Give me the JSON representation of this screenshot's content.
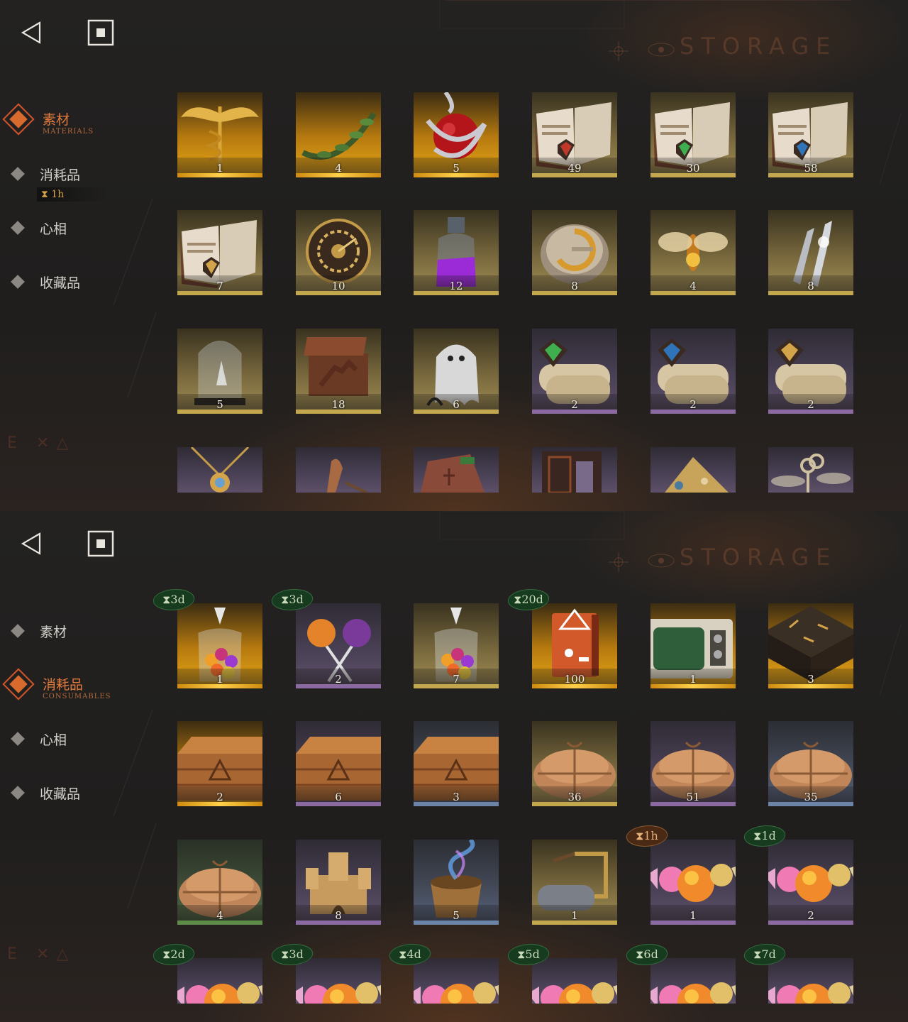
{
  "colors": {
    "accent": "#e07a3c",
    "timer": "#d4a24a",
    "rarity_gold": "#ffd04a",
    "rarity_khaki": "#c2a74e",
    "rarity_violet": "#8a6aa0",
    "rarity_steel": "#6c84a8",
    "rarity_green": "#5e8a4a"
  },
  "panel_a": {
    "header": {
      "title": "STORAGE",
      "back_icon": "back-triangle-icon",
      "home_icon": "square-stop-icon"
    },
    "sidebar": {
      "active_index": 0,
      "items": [
        {
          "label": "素材",
          "sub": "MATERIALS",
          "active": true
        },
        {
          "label": "消耗品",
          "sub": "",
          "active": false,
          "timer": "1h"
        },
        {
          "label": "心相",
          "sub": "",
          "active": false
        },
        {
          "label": "收藏品",
          "sub": "",
          "active": false
        }
      ]
    },
    "items": [
      {
        "icon": "caduceus-icon",
        "qty": "1",
        "rarity": "gold"
      },
      {
        "icon": "laurel-wreath-icon",
        "qty": "4",
        "rarity": "gold"
      },
      {
        "icon": "apple-serpent-icon",
        "qty": "5",
        "rarity": "gold"
      },
      {
        "icon": "open-book-red-gem-icon",
        "qty": "49",
        "rarity": "khaki"
      },
      {
        "icon": "open-book-green-gem-icon",
        "qty": "30",
        "rarity": "khaki"
      },
      {
        "icon": "open-book-blue-gem-icon",
        "qty": "58",
        "rarity": "khaki"
      },
      {
        "icon": "open-book-gold-gem-icon",
        "qty": "7",
        "rarity": "khaki"
      },
      {
        "icon": "astrolabe-gears-icon",
        "qty": "10",
        "rarity": "khaki"
      },
      {
        "icon": "purple-potion-bottle-icon",
        "qty": "12",
        "rarity": "khaki"
      },
      {
        "icon": "brass-puzzle-dial-icon",
        "qty": "8",
        "rarity": "khaki"
      },
      {
        "icon": "glowing-moth-icon",
        "qty": "4",
        "rarity": "khaki"
      },
      {
        "icon": "silver-bullets-icon",
        "qty": "8",
        "rarity": "khaki"
      },
      {
        "icon": "glass-bell-jar-icon",
        "qty": "5",
        "rarity": "khaki"
      },
      {
        "icon": "hand-in-box-icon",
        "qty": "18",
        "rarity": "khaki"
      },
      {
        "icon": "ghost-sheet-icon",
        "qty": "6",
        "rarity": "khaki"
      },
      {
        "icon": "scroll-green-sigil-icon",
        "qty": "2",
        "rarity": "violet"
      },
      {
        "icon": "scroll-blue-sigil-icon",
        "qty": "2",
        "rarity": "violet"
      },
      {
        "icon": "scroll-gold-sigil-icon",
        "qty": "2",
        "rarity": "violet"
      },
      {
        "icon": "gold-pendant-icon",
        "qty": "",
        "rarity": "violet",
        "cut": true
      },
      {
        "icon": "bronze-tool-icon",
        "qty": "",
        "rarity": "violet",
        "cut": true
      },
      {
        "icon": "rune-stone-icon",
        "qty": "",
        "rarity": "violet",
        "cut": true
      },
      {
        "icon": "wooden-case-icon",
        "qty": "",
        "rarity": "violet",
        "cut": true
      },
      {
        "icon": "brass-fan-icon",
        "qty": "",
        "rarity": "violet",
        "cut": true
      },
      {
        "icon": "winged-key-icon",
        "qty": "",
        "rarity": "violet",
        "cut": true
      }
    ]
  },
  "panel_b": {
    "header": {
      "title": "STORAGE",
      "back_icon": "back-triangle-icon",
      "home_icon": "square-stop-icon"
    },
    "sidebar": {
      "active_index": 1,
      "items": [
        {
          "label": "素材",
          "sub": "",
          "active": false
        },
        {
          "label": "消耗品",
          "sub": "CONSUMABLES",
          "active": true
        },
        {
          "label": "心相",
          "sub": "",
          "active": false
        },
        {
          "label": "收藏品",
          "sub": "",
          "active": false
        }
      ]
    },
    "items": [
      {
        "icon": "candy-jar-icon",
        "qty": "1",
        "rarity": "gold",
        "timer": "3d",
        "timer_style": "green"
      },
      {
        "icon": "lollipops-icon",
        "qty": "2",
        "rarity": "violet",
        "timer": "3d",
        "timer_style": "green"
      },
      {
        "icon": "candy-jar-icon",
        "qty": "7",
        "rarity": "khaki"
      },
      {
        "icon": "orange-tome-icon",
        "qty": "100",
        "rarity": "gold",
        "timer": "20d",
        "timer_style": "green"
      },
      {
        "icon": "old-tv-icon",
        "qty": "1",
        "rarity": "gold"
      },
      {
        "icon": "rune-table-icon",
        "qty": "3",
        "rarity": "gold"
      },
      {
        "icon": "wooden-crate-icon",
        "qty": "2",
        "rarity": "gold"
      },
      {
        "icon": "wooden-crate-icon",
        "qty": "6",
        "rarity": "violet"
      },
      {
        "icon": "wooden-crate-icon",
        "qty": "3",
        "rarity": "steel"
      },
      {
        "icon": "cloth-bundle-icon",
        "qty": "36",
        "rarity": "khaki"
      },
      {
        "icon": "cloth-bundle-icon",
        "qty": "51",
        "rarity": "violet"
      },
      {
        "icon": "cloth-bundle-icon",
        "qty": "35",
        "rarity": "steel"
      },
      {
        "icon": "cloth-bundle-icon",
        "qty": "4",
        "rarity": "green"
      },
      {
        "icon": "sand-castle-icon",
        "qty": "8",
        "rarity": "violet"
      },
      {
        "icon": "magic-bucket-icon",
        "qty": "5",
        "rarity": "steel"
      },
      {
        "icon": "paint-roller-icon",
        "qty": "1",
        "rarity": "khaki"
      },
      {
        "icon": "wrapped-candies-icon",
        "qty": "1",
        "rarity": "violet",
        "timer": "1h",
        "timer_style": "orange"
      },
      {
        "icon": "wrapped-candies-icon",
        "qty": "2",
        "rarity": "violet",
        "timer": "1d",
        "timer_style": "green"
      },
      {
        "icon": "wrapped-candies-icon",
        "qty": "",
        "rarity": "violet",
        "timer": "2d",
        "timer_style": "green",
        "cut": true
      },
      {
        "icon": "wrapped-candies-icon",
        "qty": "",
        "rarity": "violet",
        "timer": "3d",
        "timer_style": "green",
        "cut": true
      },
      {
        "icon": "wrapped-candies-icon",
        "qty": "",
        "rarity": "violet",
        "timer": "4d",
        "timer_style": "green",
        "cut": true
      },
      {
        "icon": "wrapped-candies-icon",
        "qty": "",
        "rarity": "violet",
        "timer": "5d",
        "timer_style": "green",
        "cut": true
      },
      {
        "icon": "wrapped-candies-icon",
        "qty": "",
        "rarity": "violet",
        "timer": "6d",
        "timer_style": "green",
        "cut": true
      },
      {
        "icon": "wrapped-candies-icon",
        "qty": "",
        "rarity": "violet",
        "timer": "7d",
        "timer_style": "green",
        "cut": true
      }
    ]
  }
}
